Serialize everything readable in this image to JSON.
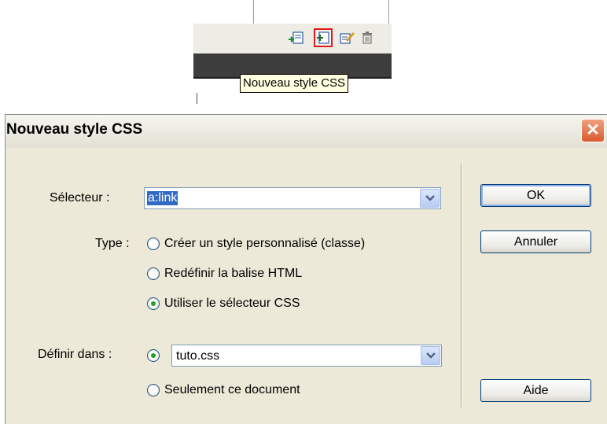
{
  "tooltip": "Nouveau style CSS",
  "toolbar": {
    "icons": [
      "attach-stylesheet-icon",
      "new-css-style-icon",
      "edit-style-icon",
      "delete-style-icon"
    ]
  },
  "dialog": {
    "title": "Nouveau style CSS",
    "close_glyph": "✕",
    "selector": {
      "label": "Sélecteur :",
      "value": "a:link"
    },
    "type": {
      "label": "Type :",
      "options": [
        {
          "label": "Créer un style personnalisé (classe)",
          "checked": false
        },
        {
          "label": "Redéfinir la balise HTML",
          "checked": false
        },
        {
          "label": "Utiliser le sélecteur CSS",
          "checked": true
        }
      ]
    },
    "define_in": {
      "label": "Définir dans :",
      "file_value": "tuto.css",
      "file_checked": true,
      "doc_option": "Seulement ce document",
      "doc_checked": false
    },
    "buttons": {
      "ok": "OK",
      "cancel": "Annuler",
      "help": "Aide"
    }
  },
  "colors": {
    "dialog_bg": "#ece9d8",
    "highlight": "#316ac5",
    "tooltip_bg": "#ffffe1",
    "selection_border": "#e01818",
    "close_button": "#d85a30"
  }
}
